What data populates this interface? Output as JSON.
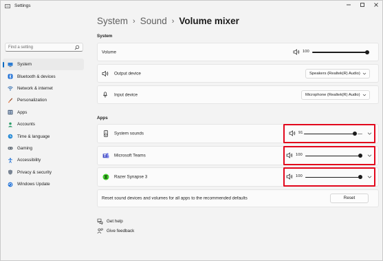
{
  "window": {
    "title": "Settings",
    "controls": [
      "minimize",
      "maximize",
      "close"
    ]
  },
  "search": {
    "placeholder": "Find a setting"
  },
  "sidebar": {
    "items": [
      {
        "label": "System",
        "icon": "monitor-icon",
        "active": true
      },
      {
        "label": "Bluetooth & devices",
        "icon": "bluetooth-icon"
      },
      {
        "label": "Network & internet",
        "icon": "wifi-icon"
      },
      {
        "label": "Personalization",
        "icon": "brush-icon"
      },
      {
        "label": "Apps",
        "icon": "apps-icon"
      },
      {
        "label": "Accounts",
        "icon": "person-icon"
      },
      {
        "label": "Time & language",
        "icon": "globe-clock-icon"
      },
      {
        "label": "Gaming",
        "icon": "gamepad-icon"
      },
      {
        "label": "Accessibility",
        "icon": "accessibility-icon"
      },
      {
        "label": "Privacy & security",
        "icon": "shield-icon"
      },
      {
        "label": "Windows Update",
        "icon": "update-icon"
      }
    ]
  },
  "breadcrumb": {
    "part1": "System",
    "part2": "Sound",
    "current": "Volume mixer"
  },
  "system_section": {
    "heading": "System",
    "volume": {
      "label": "Volume",
      "value": "100",
      "level": 1.0
    },
    "output": {
      "label": "Output device",
      "value": "Speakers (Realtek(R) Audio)"
    },
    "input": {
      "label": "Input device",
      "value": "Microphone (Realtek(R) Audio)"
    }
  },
  "apps_section": {
    "heading": "Apps",
    "apps": [
      {
        "name": "System sounds",
        "icon": "system-sounds-icon",
        "value": "91",
        "level": 0.91
      },
      {
        "name": "Microsoft Teams",
        "icon": "teams-icon",
        "value": "100",
        "level": 1.0
      },
      {
        "name": "Razer Synapse 3",
        "icon": "razer-icon",
        "value": "100",
        "level": 1.0
      }
    ],
    "reset": {
      "label": "Reset sound devices and volumes for all apps to the recommended defaults",
      "button": "Reset"
    }
  },
  "footer": {
    "help": "Get help",
    "feedback": "Give feedback"
  },
  "colors": {
    "accent": "#0067c0",
    "highlight": "#e2061b",
    "teams": "#5059c9",
    "razer": "#44d62c"
  }
}
